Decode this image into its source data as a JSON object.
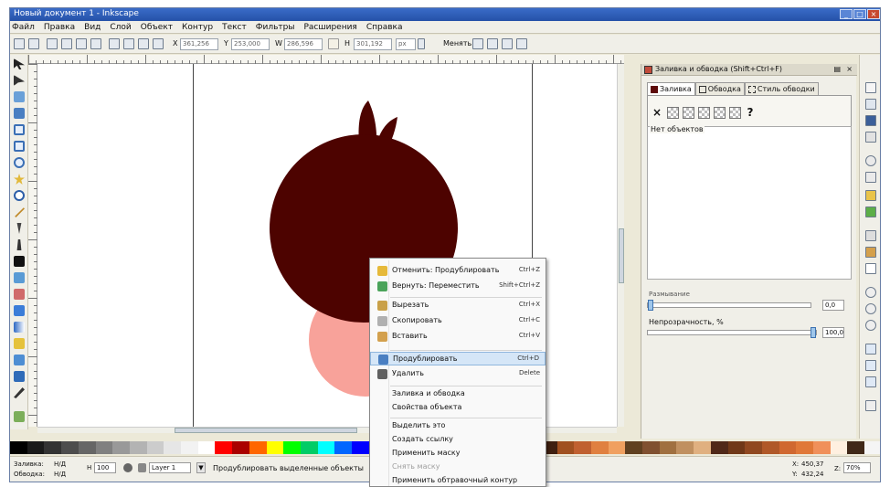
{
  "window": {
    "title": "Новый документ 1 - Inkscape"
  },
  "menubar": {
    "items": [
      "Файл",
      "Правка",
      "Вид",
      "Слой",
      "Объект",
      "Контур",
      "Текст",
      "Фильтры",
      "Расширения",
      "Справка"
    ]
  },
  "toolbar": {
    "x_value": "361,256",
    "y_value": "253,000",
    "w_value": "286,596",
    "h_value": "301,192",
    "units": "px",
    "transform_label": "Менять:"
  },
  "fill_stroke_panel": {
    "title": "Заливка и обводка (Shift+Ctrl+F)",
    "tabs": [
      "Заливка",
      "Обводка",
      "Стиль обводки"
    ],
    "no_objects": "Нет объектов",
    "blur_label": "Размывание",
    "blur_value": "0,0",
    "blur_level": 0,
    "opacity_label": "Непрозрачность, %",
    "opacity_value": "100,0",
    "opacity_level": 1.0
  },
  "context_menu": {
    "items": [
      {
        "label": "Отменить: Продублировать",
        "shortcut": "Ctrl+Z",
        "icon": "undo-icon"
      },
      {
        "label": "Вернуть: Переместить",
        "shortcut": "Shift+Ctrl+Z",
        "icon": "redo-icon"
      },
      {
        "label": "Вырезать",
        "shortcut": "Ctrl+X",
        "icon": "cut-icon"
      },
      {
        "label": "Скопировать",
        "shortcut": "Ctrl+C",
        "icon": "copy-icon"
      },
      {
        "label": "Вставить",
        "shortcut": "Ctrl+V",
        "icon": "paste-icon"
      },
      {
        "label": "Продублировать",
        "shortcut": "Ctrl+D",
        "icon": "duplicate-icon"
      },
      {
        "label": "Удалить",
        "shortcut": "Delete",
        "icon": "delete-icon"
      },
      {
        "label": "Заливка и обводка",
        "shortcut": ""
      },
      {
        "label": "Свойства объекта",
        "shortcut": ""
      },
      {
        "label": "Выделить это",
        "shortcut": ""
      },
      {
        "label": "Создать ссылку",
        "shortcut": ""
      },
      {
        "label": "Применить маску",
        "shortcut": ""
      },
      {
        "label": "Снять маску",
        "shortcut": ""
      },
      {
        "label": "Применить обтравочный контур",
        "shortcut": ""
      }
    ]
  },
  "statusbar": {
    "fill_label": "Заливка:",
    "stroke_label": "Обводка:",
    "fill_value": "Н/Д",
    "stroke_value": "Н/Д",
    "opacity_value": "100",
    "layer": "Layer 1",
    "message": "Продублировать выделенные объекты",
    "x_label": "X:",
    "y_label": "Y:",
    "x_value": "450,37",
    "y_value": "432,24",
    "z_label": "Z:",
    "zoom": "70%"
  },
  "colors": {
    "pomegranate": "#4d0300",
    "pink_circle": "#f8a29a",
    "titlebar": "#2a5aae"
  },
  "palette": [
    "#000000",
    "#1a1a1a",
    "#333333",
    "#4d4d4d",
    "#666666",
    "#808080",
    "#999999",
    "#b3b3b3",
    "#cccccc",
    "#e6e6e6",
    "#f2f2f2",
    "#ffffff",
    "#ff0000",
    "#aa0000",
    "#ff6600",
    "#ffff00",
    "#00ff00",
    "#00cc66",
    "#00ffff",
    "#0066ff",
    "#0000ff",
    "#6600ff",
    "#ff00ff",
    "#800000",
    "#a06040",
    "#c08060",
    "#d0a080",
    "#e0c0a0",
    "#f0d8c0",
    "#804020",
    "#603018",
    "#402010",
    "#a05020",
    "#c06030",
    "#e08040",
    "#f0a060",
    "#604020",
    "#805030",
    "#a07040",
    "#c09060",
    "#e0b080",
    "#502818",
    "#703818",
    "#904820",
    "#b05828",
    "#d06830",
    "#e07838",
    "#f0905a",
    "#fff0e0",
    "#402818",
    "#f5f5f5"
  ]
}
